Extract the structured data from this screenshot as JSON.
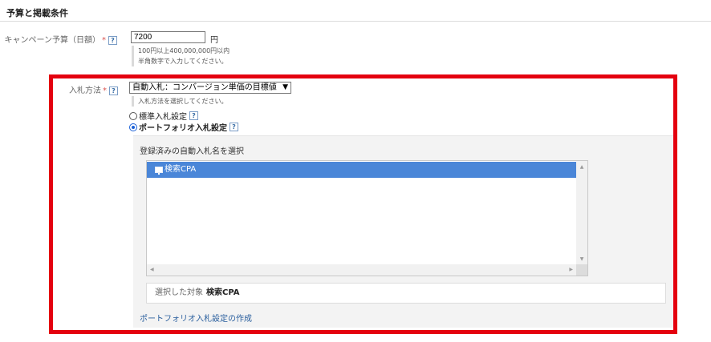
{
  "section": {
    "title": "予算と掲載条件"
  },
  "budget": {
    "label": "キャンペーン予算（日額）",
    "required_mark": "*",
    "help": "?",
    "value": "7200",
    "unit": "円",
    "note_line1": "100円以上400,000,000円以内",
    "note_line2": "半角数字で入力してください。"
  },
  "bidding": {
    "label": "入札方法",
    "required_mark": "*",
    "help": "?",
    "selected": "自動入札：コンバージョン単価の目標値",
    "note": "入札方法を選択してください。",
    "options": [
      {
        "label": "標準入札設定",
        "checked": false,
        "help": "?"
      },
      {
        "label": "ポートフォリオ入札設定",
        "checked": true,
        "help": "?"
      }
    ]
  },
  "portfolio": {
    "panel_title": "登録済みの自動入札名を選択",
    "items": [
      {
        "label": "検索CPA",
        "selected": true
      }
    ],
    "selected_label": "選択した対象",
    "selected_value": "検索CPA",
    "create_link": "ポートフォリオ入札設定の作成"
  },
  "colors": {
    "highlight": "#e4000f",
    "selection": "#4a86d8",
    "link": "#2a5f9e",
    "required": "#d9534f"
  }
}
